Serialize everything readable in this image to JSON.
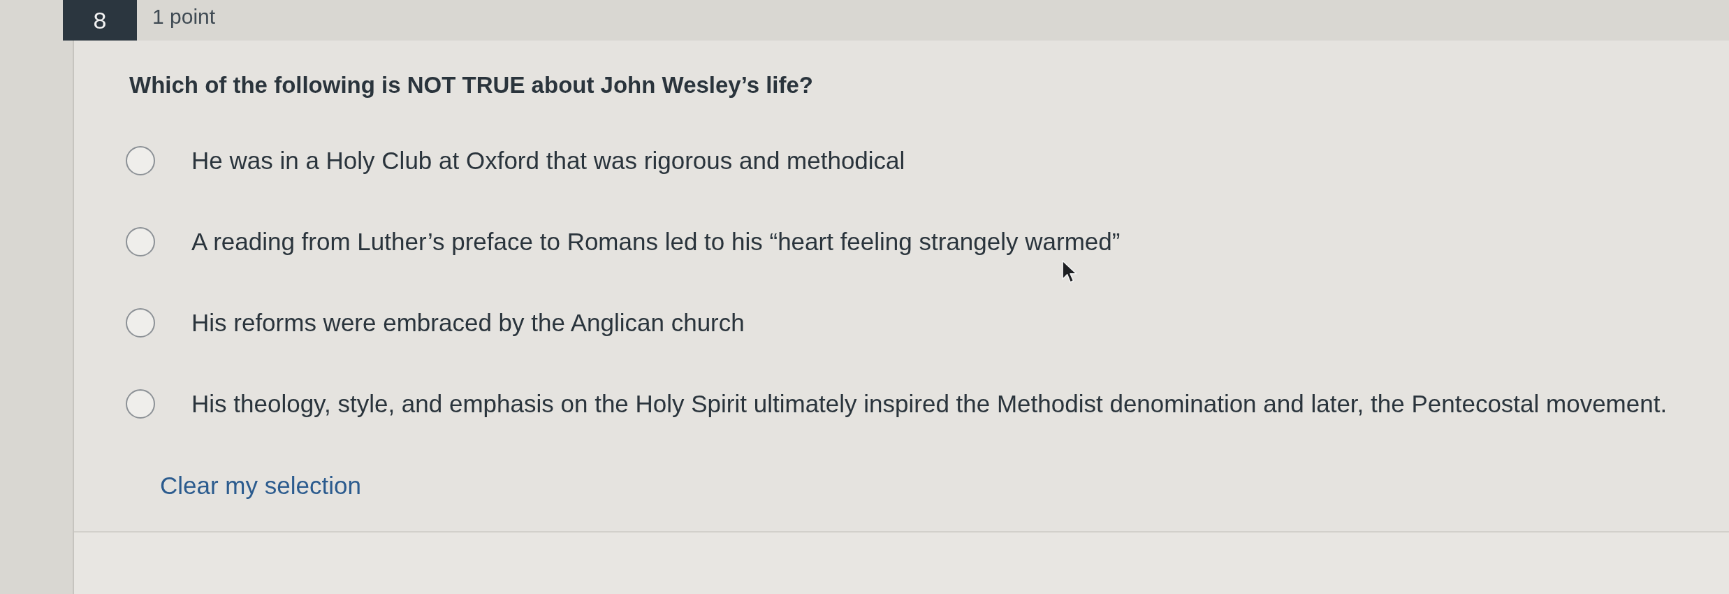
{
  "question": {
    "number": "8",
    "points": "1 point",
    "text": "Which of the following is NOT TRUE about John Wesley’s life?"
  },
  "options": [
    {
      "label": "He was in a Holy Club at Oxford that was rigorous and methodical",
      "selected": false
    },
    {
      "label": "A reading from Luther’s preface to Romans led to his “heart feeling strangely warmed”",
      "selected": false
    },
    {
      "label": "His reforms were embraced by the Anglican church",
      "selected": false
    },
    {
      "label": "His theology, style, and emphasis on the Holy Spirit ultimately inspired the Methodist denomination and later, the Pentecostal movement.",
      "selected": false
    }
  ],
  "clear_link": "Clear my selection"
}
